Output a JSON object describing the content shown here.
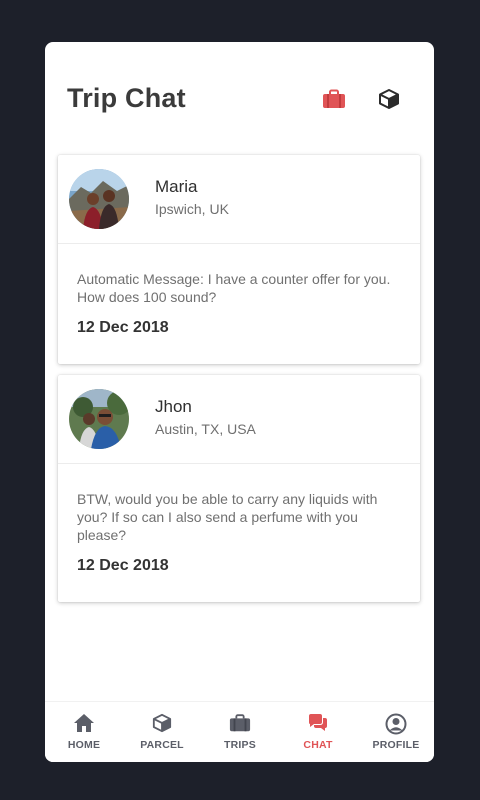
{
  "header": {
    "title": "Trip Chat",
    "trips_icon": "briefcase-icon",
    "parcel_icon": "box-icon"
  },
  "chats": [
    {
      "name": "Maria",
      "location": "Ipswich, UK",
      "message": "Automatic Message: I have a counter offer for you. How does 100 sound?",
      "date": "12 Dec 2018"
    },
    {
      "name": "Jhon",
      "location": "Austin, TX, USA",
      "message": "BTW, would you be able to carry any liquids with you? If so can I also send a perfume with you please?",
      "date": "12 Dec 2018"
    }
  ],
  "nav": {
    "items": [
      {
        "label": "HOME",
        "icon": "home-icon"
      },
      {
        "label": "PARCEL",
        "icon": "box-icon"
      },
      {
        "label": "TRIPS",
        "icon": "briefcase-icon"
      },
      {
        "label": "CHAT",
        "icon": "chat-icon",
        "active": true
      },
      {
        "label": "PROFILE",
        "icon": "user-circle-icon"
      }
    ]
  },
  "colors": {
    "accent": "#e05456",
    "background": "#1d202a",
    "nav_text": "#5b5e68"
  }
}
